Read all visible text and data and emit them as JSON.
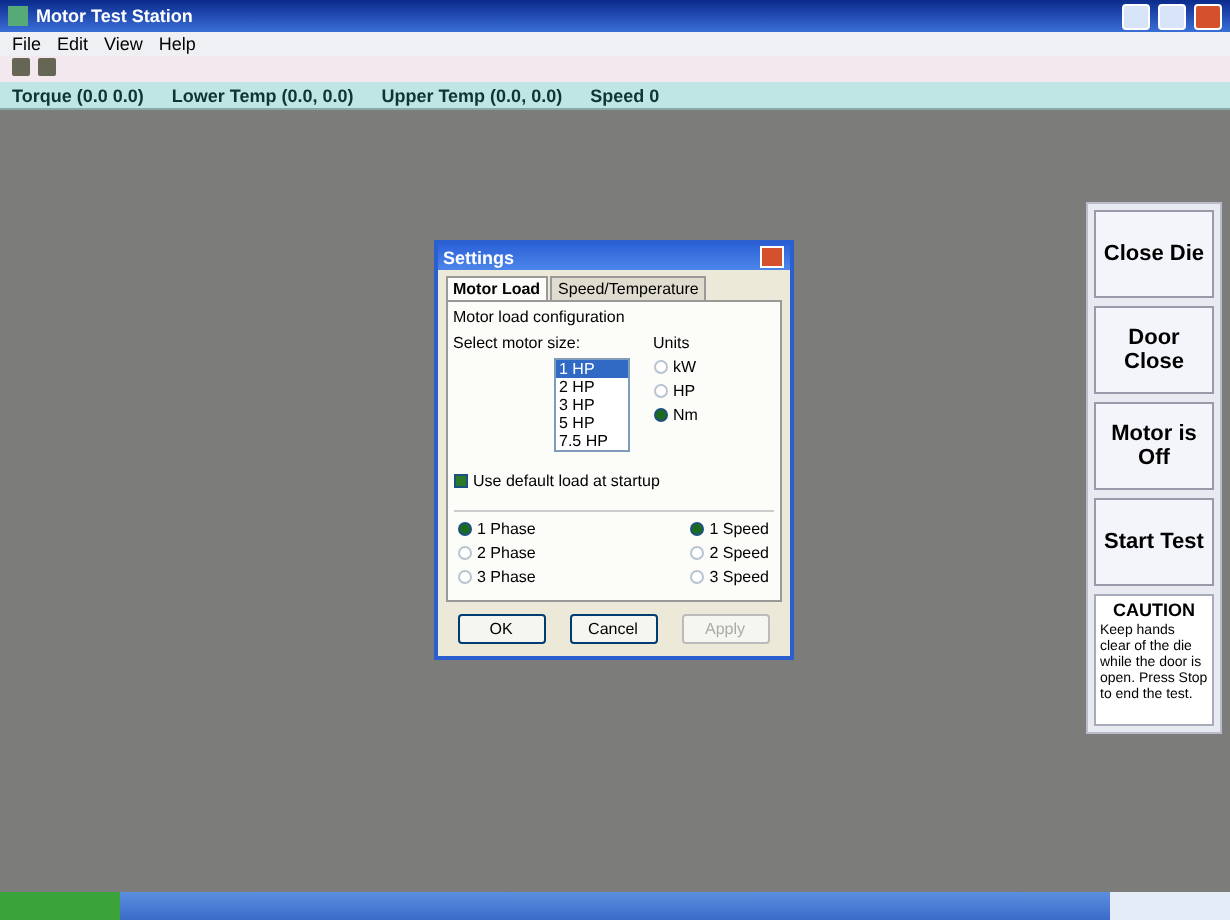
{
  "window": {
    "title": "Motor Test Station"
  },
  "menu": [
    "File",
    "Edit",
    "View",
    "Help"
  ],
  "info_bar": [
    "Torque (0.0 0.0)",
    "Lower Temp (0.0, 0.0)",
    "Upper Temp (0.0, 0.0)",
    "Speed 0"
  ],
  "dialog": {
    "title": "Settings",
    "tabs": [
      {
        "label": "Motor Load",
        "selected": true
      },
      {
        "label": "Speed/Temperature",
        "selected": false
      }
    ],
    "group": "Motor load configuration",
    "size_label": "Select motor size:",
    "sizes": [
      {
        "label": "1 HP",
        "selected": true
      },
      {
        "label": "2 HP",
        "selected": false
      },
      {
        "label": "3 HP",
        "selected": false
      },
      {
        "label": "5 HP",
        "selected": false
      },
      {
        "label": "7.5 HP",
        "selected": false
      }
    ],
    "units_label": "Units",
    "units": [
      {
        "label": "kW",
        "selected": false
      },
      {
        "label": "HP",
        "selected": false
      },
      {
        "label": "Nm",
        "selected": true
      }
    ],
    "default_load": {
      "label": "Use default load at startup",
      "checked": true
    },
    "left_options": [
      {
        "label": "1 Phase",
        "selected": true
      },
      {
        "label": "2 Phase",
        "selected": false
      },
      {
        "label": "3 Phase",
        "selected": false
      }
    ],
    "right_options": [
      {
        "label": "1 Speed",
        "selected": true
      },
      {
        "label": "2 Speed",
        "selected": false
      },
      {
        "label": "3 Speed",
        "selected": false
      }
    ],
    "buttons": [
      {
        "label": "OK",
        "disabled": false
      },
      {
        "label": "Cancel",
        "disabled": false
      },
      {
        "label": "Apply",
        "disabled": true
      }
    ]
  },
  "side_buttons": [
    "Close Die",
    "Door Close",
    "Motor is Off",
    "Start Test"
  ],
  "side_note": {
    "title": "CAUTION",
    "text": "Keep hands clear of the die while the door is open. Press Stop to end the test."
  }
}
